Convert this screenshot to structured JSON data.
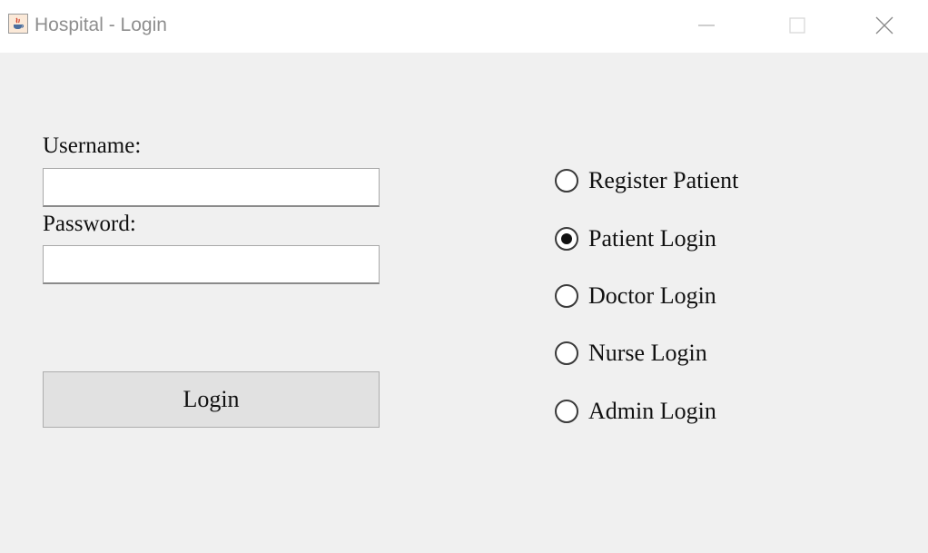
{
  "window": {
    "title": "Hospital - Login",
    "icon": "java-icon",
    "controls": [
      "minimize-icon",
      "maximize-icon",
      "close-icon"
    ]
  },
  "form": {
    "username_label": "Username:",
    "username_value": "",
    "password_label": "Password:",
    "password_value": "",
    "login_button": "Login"
  },
  "roles": [
    {
      "label": "Register Patient",
      "checked": false
    },
    {
      "label": "Patient Login",
      "checked": true
    },
    {
      "label": "Doctor Login",
      "checked": false
    },
    {
      "label": "Nurse Login",
      "checked": false
    },
    {
      "label": "Admin Login",
      "checked": false
    }
  ],
  "colors": {
    "background": "#f0f0f0",
    "titlebar": "#ffffff",
    "button": "#e1e1e1"
  }
}
